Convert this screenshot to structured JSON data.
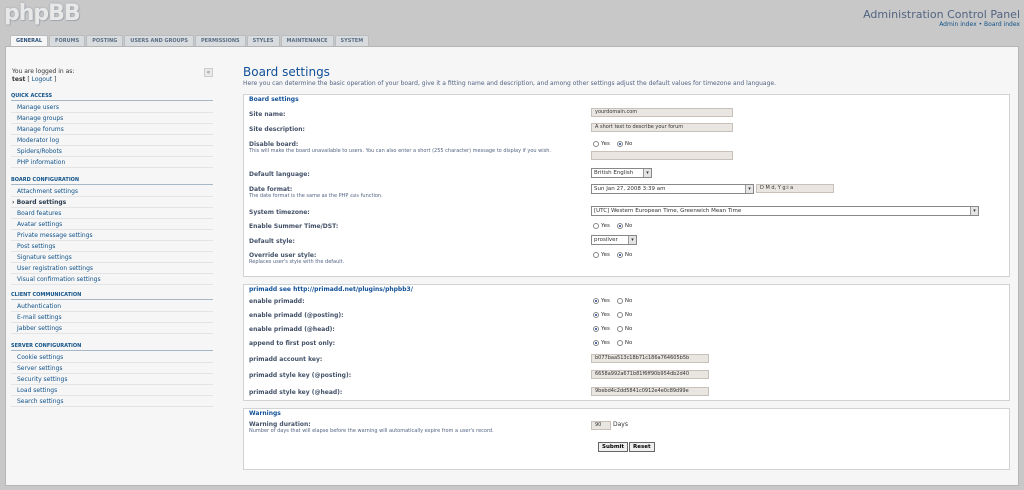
{
  "header": {
    "logo": "phpBB",
    "title": "Administration Control Panel",
    "link_admin": "Admin index",
    "separator": "•",
    "link_board": "Board index"
  },
  "tabs": [
    "GENERAL",
    "FORUMS",
    "POSTING",
    "USERS AND GROUPS",
    "PERMISSIONS",
    "STYLES",
    "MAINTENANCE",
    "SYSTEM"
  ],
  "active_tab": "GENERAL",
  "sidebar": {
    "logged_in_text": "You are logged in as:",
    "username": "test",
    "logout_open": "[",
    "logout": "Logout",
    "logout_close": "]",
    "collapse": "«",
    "sections": [
      {
        "title": "QUICK ACCESS",
        "items": [
          "Manage users",
          "Manage groups",
          "Manage forums",
          "Moderator log",
          "Spiders/Robots",
          "PHP information"
        ]
      },
      {
        "title": "BOARD CONFIGURATION",
        "items": [
          "Attachment settings",
          "Board settings",
          "Board features",
          "Avatar settings",
          "Private message settings",
          "Post settings",
          "Signature settings",
          "User registration settings",
          "Visual confirmation settings"
        ]
      },
      {
        "title": "CLIENT COMMUNICATION",
        "items": [
          "Authentication",
          "E-mail settings",
          "Jabber settings"
        ]
      },
      {
        "title": "SERVER CONFIGURATION",
        "items": [
          "Cookie settings",
          "Server settings",
          "Security settings",
          "Load settings",
          "Search settings"
        ]
      }
    ],
    "active_item": "Board settings"
  },
  "main": {
    "title": "Board settings",
    "description": "Here you can determine the basic operation of your board, give it a fitting name and description, and among other settings adjust the default values for timezone and language."
  },
  "board_settings": {
    "legend": "Board settings",
    "site_name_label": "Site name:",
    "site_name_value": "yourdomain.com",
    "site_desc_label": "Site description:",
    "site_desc_value": "A short text to describe your forum",
    "disable_label": "Disable board:",
    "disable_sub": "This will make the board unavailable to users. You can also enter a short (255 character) message to display if you wish.",
    "yes": "Yes",
    "no": "No",
    "lang_label": "Default language:",
    "lang_value": "British English",
    "date_label": "Date format:",
    "date_sub_1": "The date format is the same as the PHP",
    "date_sub_code": "date",
    "date_sub_2": "function.",
    "date_value": "Sun Jan 27, 2008 3:39 am",
    "date_format": "D M d, Y g:i a",
    "tz_label": "System timezone:",
    "tz_value": "[UTC] Western European Time, Greenwich Mean Time",
    "dst_label": "Enable Summer Time/DST:",
    "style_label": "Default style:",
    "style_value": "prosilver",
    "override_label": "Override user style:",
    "override_sub": "Replaces user's style with the default."
  },
  "primadd": {
    "legend": "primadd see http://primadd.net/plugins/phpbb3/",
    "enable_label": "enable primadd:",
    "posting_label": "enable primadd (@posting):",
    "head_label": "enable primadd (@head):",
    "first_post_label": "append to first post only:",
    "account_label": "primadd account key:",
    "account_value": "b077baa513c18b71c186a764605b5b",
    "style_posting_label": "primadd style key (@posting):",
    "style_posting_value": "6658a992a671b81f6ff90b954db2d40",
    "style_head_label": "primadd style key (@head):",
    "style_head_value": "9bebd4c2dd5841c0912e4e0c89d99e"
  },
  "warnings": {
    "legend": "Warnings",
    "duration_label": "Warning duration:",
    "duration_sub": "Number of days that will elapse before the warning will automatically expire from a user's record.",
    "duration_value": "90",
    "days": "Days"
  },
  "buttons": {
    "submit": "Submit",
    "reset": "Reset"
  }
}
